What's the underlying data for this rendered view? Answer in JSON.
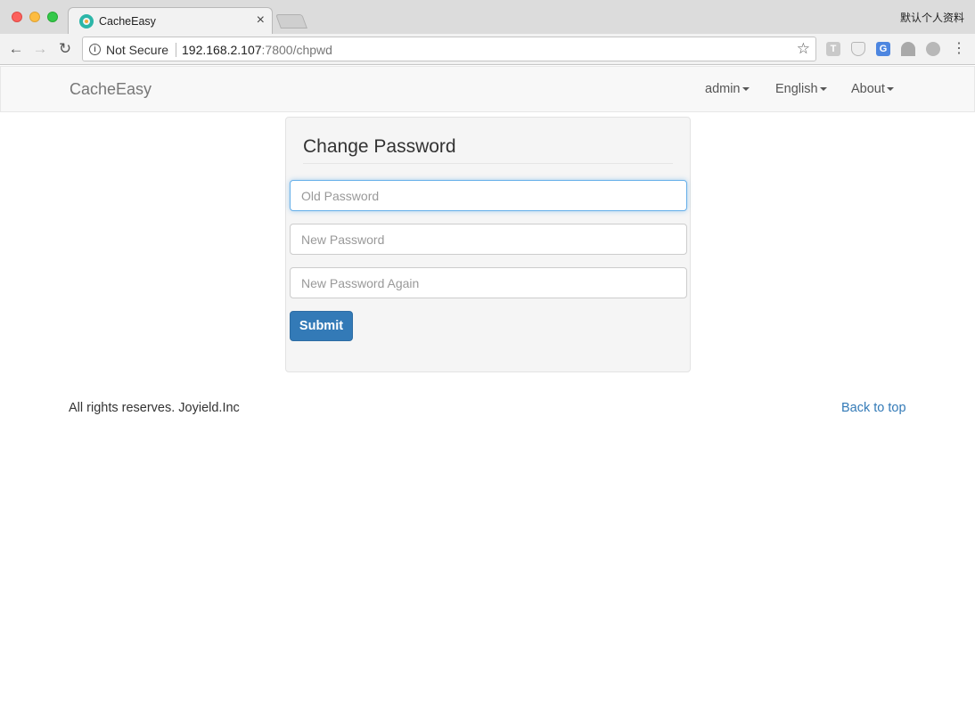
{
  "browser": {
    "tab_title": "CacheEasy",
    "tab_close": "×",
    "profile_label": "默认个人资料",
    "security_label": "Not Secure",
    "url_host": "192.168.2.107",
    "url_rest": ":7800/chpwd",
    "back_glyph": "←",
    "forward_glyph": "→",
    "reload_glyph": "↻",
    "star_glyph": "☆",
    "menu_glyph": "⋮",
    "extensions": [
      "T",
      "",
      "G",
      "",
      ""
    ]
  },
  "navbar": {
    "brand": "CacheEasy",
    "items": [
      {
        "label": "admin"
      },
      {
        "label": "English"
      },
      {
        "label": "About"
      }
    ]
  },
  "form": {
    "title": "Change Password",
    "old_password_placeholder": "Old Password",
    "new_password_placeholder": "New Password",
    "new_password_again_placeholder": "New Password Again",
    "submit_label": "Submit"
  },
  "footer": {
    "copyright": "All rights reserves. Joyield.Inc",
    "back_to_top": "Back to top"
  },
  "colors": {
    "primary": "#337ab7",
    "navbar_bg": "#f8f8f8",
    "panel_bg": "#f5f5f5",
    "focus_ring": "#66afe9"
  }
}
